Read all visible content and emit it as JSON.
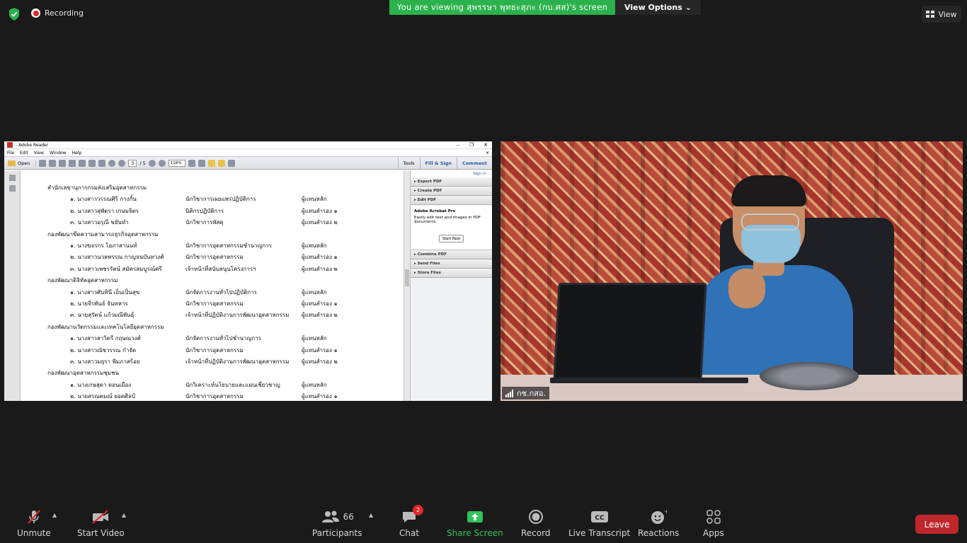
{
  "top": {
    "recording_label": "Recording",
    "viewing_banner": "You are viewing สุพรรษา พุทธะสุภะ (กบ.ศส)'s screen",
    "view_options_label": "View Options",
    "view_label": "View"
  },
  "adobe": {
    "title": "- Adobe Reader",
    "menu": [
      "File",
      "Edit",
      "View",
      "Window",
      "Help"
    ],
    "open_label": "Open",
    "page_current": "3",
    "page_total": "/ 5",
    "zoom": "118%",
    "tools_label": "Tools",
    "fill_sign_label": "Fill & Sign",
    "comment_label": "Comment",
    "panel": {
      "sign_in": "Sign In",
      "export_pdf": "Export PDF",
      "create_pdf": "Create PDF",
      "edit_pdf": "Edit PDF",
      "acrobat_pro_title": "Adobe Acrobat Pro",
      "acrobat_pro_desc": "Easily edit text and images in PDF documents",
      "start_now": "Start Now",
      "combine_pdf": "Combine PDF",
      "send_files": "Send Files",
      "store_files": "Store Files"
    },
    "doc_lines": [
      {
        "type": "head",
        "text": "สำนักเลขานุการกรมส่งเสริมอุตสาหกรรม"
      },
      {
        "type": "row",
        "name": "๑. นางสาววรรณศิริ กางกั้น",
        "role": "นักวิชาการเผยแพร่ปฏิบัติการ",
        "rep": "ผู้แทนหลัก"
      },
      {
        "type": "row",
        "name": "๒. นางสาวสุพัตรา เกษมจิตร",
        "role": "นิติกรปฏิบัติการ",
        "rep": "ผู้แทนสำรอง ๑"
      },
      {
        "type": "row",
        "name": "๓. นางสาวอรุณี ขยันทำ",
        "role": "นักวิชาการพัสดุ",
        "rep": "ผู้แทนสำรอง ๒"
      },
      {
        "type": "head",
        "text": "กองพัฒนาขีดความสามารถธุรกิจอุตสาหกรรม"
      },
      {
        "type": "row",
        "name": "๑. นางขจรกร โอภาสานนท์",
        "role": "นักวิชาการอุตสาหกรรมชำนาญการ",
        "rep": "ผู้แทนหลัก"
      },
      {
        "type": "row",
        "name": "๒. นางสาวนวลพรรณ กาญจนบันทวงศ์",
        "role": "นักวิชาการอุตสาหกรรม",
        "rep": "ผู้แทนสำรอง ๑"
      },
      {
        "type": "row",
        "name": "๓. นางสาวเพชรรัตน์ สมัครสมบูรณ์ศรี",
        "role": "เจ้าหน้าที่สนับสนุนโครงการฯ",
        "rep": "ผู้แทนสำรอง ๒"
      },
      {
        "type": "head",
        "text": "กองพัฒนาดิจิทัลอุตสาหกรรม"
      },
      {
        "type": "row",
        "name": "๑. นางสาวศันทินี เย็นเป็นสุข",
        "role": "นักจัดการงานทั่วไปปฏิบัติการ",
        "rep": "ผู้แทนหลัก"
      },
      {
        "type": "row",
        "name": "๒. นายจีรพันธ์ จันทหาร",
        "role": "นักวิชาการอุตสาหกรรม",
        "rep": "ผู้แทนสำรอง ๑"
      },
      {
        "type": "row",
        "name": "๓. นายสุรัตน์ แก้วมณีพันธุ์",
        "role": "เจ้าหน้าที่ปฏิบัติงานการพัฒนาอุตสาหกรรม",
        "rep": "ผู้แทนสำรอง ๒"
      },
      {
        "type": "head",
        "text": "กองพัฒนานวัตกรรมและเทคโนโลยีอุตสาหกรรม"
      },
      {
        "type": "row",
        "name": "๑. นางสาวสาวิตรี กฤษณวงศ์",
        "role": "นักจัดการงานทั่วไปชำนาญการ",
        "rep": "ผู้แทนหลัก"
      },
      {
        "type": "row",
        "name": "๒. นางสาวณัชวรรณ กำจัด",
        "role": "นักวิชาการอุตสาหกรรม",
        "rep": "ผู้แทนสำรอง ๑"
      },
      {
        "type": "row",
        "name": "๓. นางสาวมยุรา พิมภาสร้อย",
        "role": "เจ้าหน้าที่ปฏิบัติงานการพัฒนาอุตสาหกรรม",
        "rep": "ผู้แทนสำรอง ๒"
      },
      {
        "type": "head",
        "text": "กองพัฒนาอุตสาหกรรมชุมชน"
      },
      {
        "type": "row",
        "name": "๑. นางเกษสุดา ดอนเมือง",
        "role": "นักวิเคราะห์นโยบายและแผนเชี่ยวชาญ",
        "rep": "ผู้แทนหลัก"
      },
      {
        "type": "row",
        "name": "๒. นายสรณคมณ์ ยอดศิลป์",
        "role": "นักวิชาการอุตสาหกรรม",
        "rep": "ผู้แทนสำรอง ๑"
      }
    ]
  },
  "video": {
    "participant_name": "กช.กสอ."
  },
  "toolbar": {
    "unmute": "Unmute",
    "start_video": "Start Video",
    "participants": "Participants",
    "participants_count": "66",
    "chat": "Chat",
    "chat_badge": "2",
    "share_screen": "Share Screen",
    "record": "Record",
    "live_transcript": "Live Transcript",
    "reactions": "Reactions",
    "apps": "Apps",
    "leave": "Leave"
  }
}
